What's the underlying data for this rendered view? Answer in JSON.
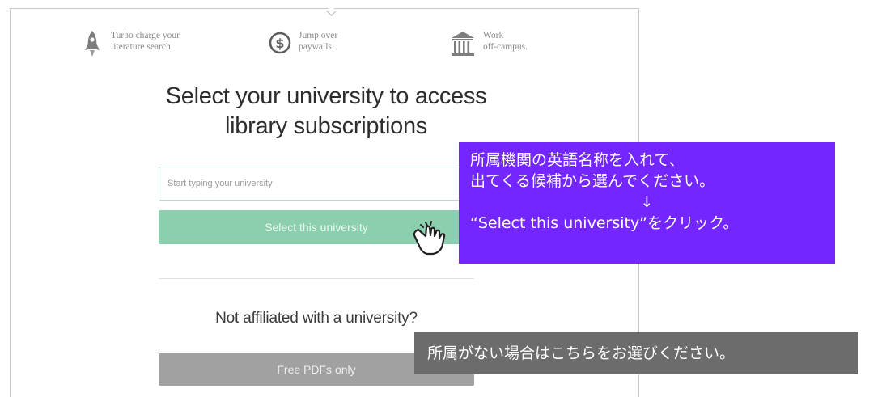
{
  "features": [
    {
      "icon": "rocket-icon",
      "line1": "Turbo charge your",
      "line2": "literature search."
    },
    {
      "icon": "dollar-coin-icon",
      "line1": "Jump over",
      "line2": "paywalls."
    },
    {
      "icon": "university-building-icon",
      "line1": "Work",
      "line2": "off-campus."
    }
  ],
  "heading": {
    "line1": "Select your university to access",
    "line2": "library subscriptions"
  },
  "search": {
    "placeholder": "Start typing your university",
    "value": ""
  },
  "select_button": {
    "label": "Select this university",
    "color": "#8ccfae"
  },
  "not_affiliated": {
    "text": "Not affiliated with a university?"
  },
  "free_button": {
    "label": "Free PDFs only",
    "color": "#a1a1a1"
  },
  "annotations": {
    "callout": {
      "line1": "所属機関の英語名称を入れて、",
      "line2": "出てくる候補から選んでください。",
      "arrow": "↓",
      "line3": "“Select this university”をクリック。",
      "color": "#7326ff"
    },
    "note": {
      "text": "所属がない場合はこちらをお選びください。",
      "color": "#6c6c6c"
    },
    "pointer_icon": "hand-pointer-icon"
  }
}
